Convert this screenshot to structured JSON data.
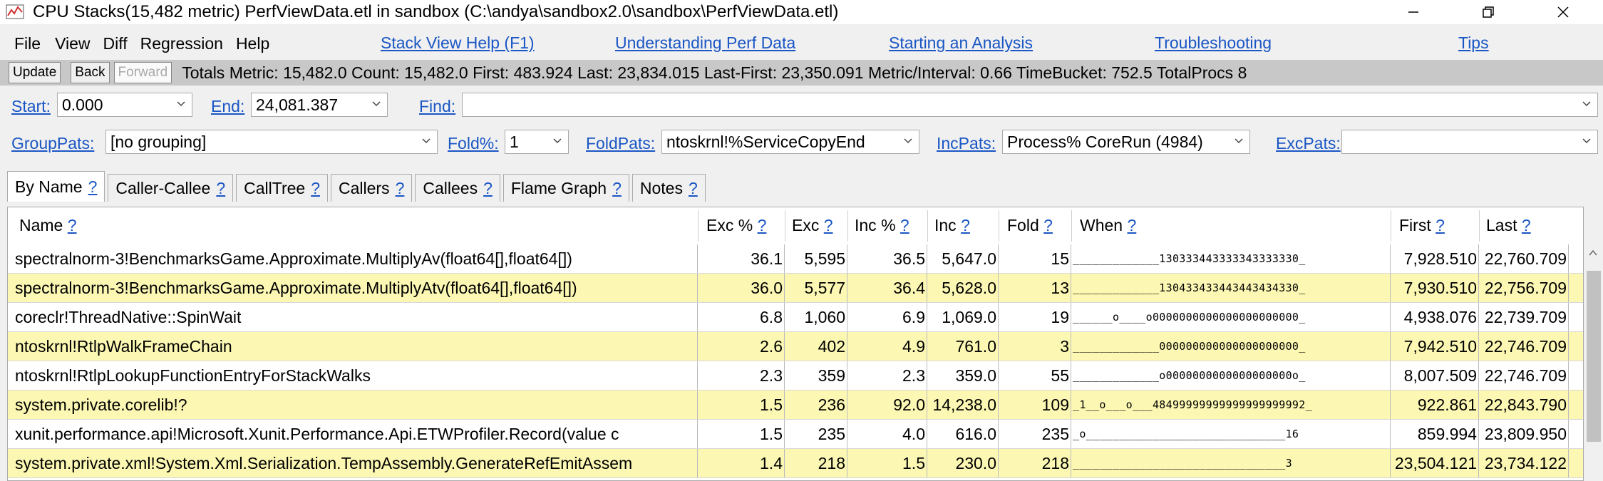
{
  "window": {
    "title": "CPU Stacks(15,482 metric) PerfViewData.etl in sandbox (C:\\andya\\sandbox2.0\\sandbox\\PerfViewData.etl)"
  },
  "menu": {
    "items": [
      "File",
      "View",
      "Diff",
      "Regression",
      "Help"
    ],
    "help_links": [
      "Stack View Help (F1)",
      "Understanding Perf Data",
      "Starting an Analysis",
      "Troubleshooting",
      "Tips"
    ]
  },
  "toolbar": {
    "update": "Update",
    "back": "Back",
    "forward": "Forward",
    "totals": "Totals Metric: 15,482.0  Count: 15,482.0  First: 483.924  Last: 23,834.015  Last-First: 23,350.091  Metric/Interval: 0.66  TimeBucket: 752.5  TotalProcs 8"
  },
  "range": {
    "start_label": "Start:",
    "start_value": "0.000",
    "end_label": "End:",
    "end_value": "24,081.387",
    "find_label": "Find:",
    "find_value": ""
  },
  "filters": {
    "grouppats_label": "GroupPats:",
    "grouppats_value": "[no grouping]",
    "fold_label": "Fold%:",
    "fold_value": "1",
    "foldpats_label": "FoldPats:",
    "foldpats_value": "ntoskrnl!%ServiceCopyEnd",
    "incpats_label": "IncPats:",
    "incpats_value": "Process% CoreRun (4984)",
    "excpats_label": "ExcPats:",
    "excpats_value": ""
  },
  "tabs": [
    "By Name",
    "Caller-Callee",
    "CallTree",
    "Callers",
    "Callees",
    "Flame Graph",
    "Notes"
  ],
  "help_mark": "?",
  "grid": {
    "columns": [
      "Name",
      "Exc %",
      "Exc",
      "Inc %",
      "Inc",
      "Fold",
      "When",
      "First",
      "Last"
    ],
    "rows": [
      {
        "name": "spectralnorm-3!BenchmarksGame.Approximate.MultiplyAv(float64[],float64[])",
        "exc_pct": "36.1",
        "exc": "5,595",
        "inc_pct": "36.5",
        "inc": "5,647.0",
        "fold": "15",
        "when": "_____________130333443333343333330_",
        "first": "7,928.510",
        "last": "22,760.709"
      },
      {
        "name": "spectralnorm-3!BenchmarksGame.Approximate.MultiplyAtv(float64[],float64[])",
        "exc_pct": "36.0",
        "exc": "5,577",
        "inc_pct": "36.4",
        "inc": "5,628.0",
        "fold": "13",
        "when": "_____________130433433443443434330_",
        "first": "7,930.510",
        "last": "22,756.709"
      },
      {
        "name": "coreclr!ThreadNative::SpinWait",
        "exc_pct": "6.8",
        "exc": "1,060",
        "inc_pct": "6.9",
        "inc": "1,069.0",
        "fold": "19",
        "when": "______o____o0000000000000000000000_",
        "first": "4,938.076",
        "last": "22,739.709"
      },
      {
        "name": "ntoskrnl!RtlpWalkFrameChain",
        "exc_pct": "2.6",
        "exc": "402",
        "inc_pct": "4.9",
        "inc": "761.0",
        "fold": "3",
        "when": "_____________000000000000000000000_",
        "first": "7,942.510",
        "last": "22,746.709"
      },
      {
        "name": "ntoskrnl!RtlpLookupFunctionEntryForStackWalks",
        "exc_pct": "2.3",
        "exc": "359",
        "inc_pct": "2.3",
        "inc": "359.0",
        "fold": "55",
        "when": "_____________o0000000000000000000o_",
        "first": "8,007.509",
        "last": "22,746.709"
      },
      {
        "name": "system.private.corelib!?",
        "exc_pct": "1.5",
        "exc": "236",
        "inc_pct": "92.0",
        "inc": "14,238.0",
        "fold": "109",
        "when": "_1__o___o___48499999999999999999992_",
        "first": "922.861",
        "last": "22,843.790"
      },
      {
        "name": "xunit.performance.api!Microsoft.Xunit.Performance.Api.ETWProfiler.Record(value c",
        "exc_pct": "1.5",
        "exc": "235",
        "inc_pct": "4.0",
        "inc": "616.0",
        "fold": "235",
        "when": "_o______________________________16",
        "first": "859.994",
        "last": "23,809.950"
      },
      {
        "name": "system.private.xml!System.Xml.Serialization.TempAssembly.GenerateRefEmitAssem",
        "exc_pct": "1.4",
        "exc": "218",
        "inc_pct": "1.5",
        "inc": "230.0",
        "fold": "218",
        "when": "________________________________3",
        "first": "23,504.121",
        "last": "23,734.122"
      }
    ]
  },
  "colors": {
    "alt_row": "#fcf8b4",
    "link": "#1a56c4",
    "toolbar_bg": "#c8c8c8"
  }
}
